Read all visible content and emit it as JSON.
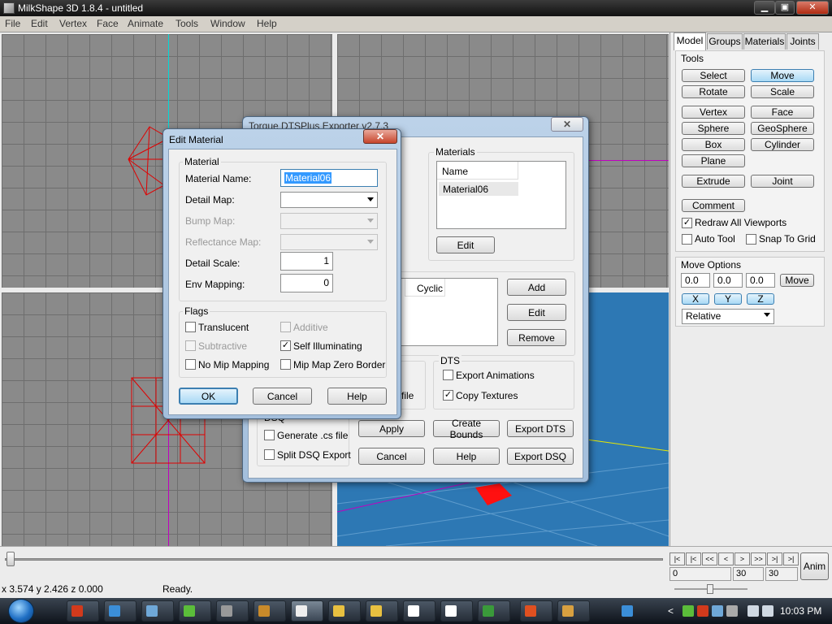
{
  "window": {
    "title": "MilkShape 3D 1.8.4 - untitled"
  },
  "menu": [
    "File",
    "Edit",
    "Vertex",
    "Face",
    "Animate",
    "Tools",
    "Window",
    "Help"
  ],
  "right_panel": {
    "tabs": [
      "Model",
      "Groups",
      "Materials",
      "Joints"
    ],
    "tools_title": "Tools",
    "tool_buttons": [
      "Select",
      "Move",
      "Rotate",
      "Scale",
      "Vertex",
      "Face",
      "Sphere",
      "GeoSphere",
      "Box",
      "Cylinder",
      "Plane",
      "Extrude",
      "Joint",
      "Comment"
    ],
    "redraw_all": "Redraw All Viewports",
    "auto_tool": "Auto Tool",
    "snap_to_grid": "Snap To Grid",
    "move_options_title": "Move Options",
    "move_values": [
      "0.0",
      "0.0",
      "0.0"
    ],
    "move_button": "Move",
    "axis_buttons": [
      "X",
      "Y",
      "Z"
    ],
    "mode_select": "Relative"
  },
  "torque_dialog": {
    "title": "Torque DTSPlus Exporter v2.7.3",
    "materials_title": "Materials",
    "materials_column": "Name",
    "materials_rows": [
      "Material06"
    ],
    "edit_button": "Edit",
    "seq_column": "Cyclic",
    "add_button": "Add",
    "seq_edit_button": "Edit",
    "remove_button": "Remove",
    "dts_title": "DTS",
    "export_animations": "Export Animations",
    "copy_textures": "Copy Textures",
    "partial_label": "file",
    "dsq_title": "DSQ",
    "generate_cs": "Generate .cs file",
    "split_dsq": "Split DSQ Export",
    "apply_button": "Apply",
    "create_bounds_button": "Create Bounds",
    "export_dts_button": "Export DTS",
    "cancel_button": "Cancel",
    "help_button": "Help",
    "export_dsq_button": "Export DSQ"
  },
  "edit_material": {
    "title": "Edit Material",
    "material_group": "Material",
    "material_name_label": "Material Name:",
    "material_name_value": "Material06",
    "detail_map_label": "Detail Map:",
    "bump_map_label": "Bump Map:",
    "reflectance_map_label": "Reflectance Map:",
    "detail_scale_label": "Detail Scale:",
    "detail_scale_value": "1",
    "env_mapping_label": "Env Mapping:",
    "env_mapping_value": "0",
    "flags_group": "Flags",
    "translucent": "Translucent",
    "additive": "Additive",
    "subtractive": "Subtractive",
    "self_illuminating": "Self Illuminating",
    "no_mip_mapping": "No Mip Mapping",
    "mip_map_zero_border": "Mip Map Zero Border",
    "ok_button": "OK",
    "cancel_button": "Cancel",
    "help_button": "Help"
  },
  "timeline": {
    "frame_start": "0",
    "frame_current": "30",
    "frame_total": "30",
    "anim_button": "Anim"
  },
  "status": {
    "coords": "x 3.574 y 2.426 z 0.000",
    "message": "Ready."
  },
  "taskbar": {
    "clock": "10:03 PM"
  }
}
